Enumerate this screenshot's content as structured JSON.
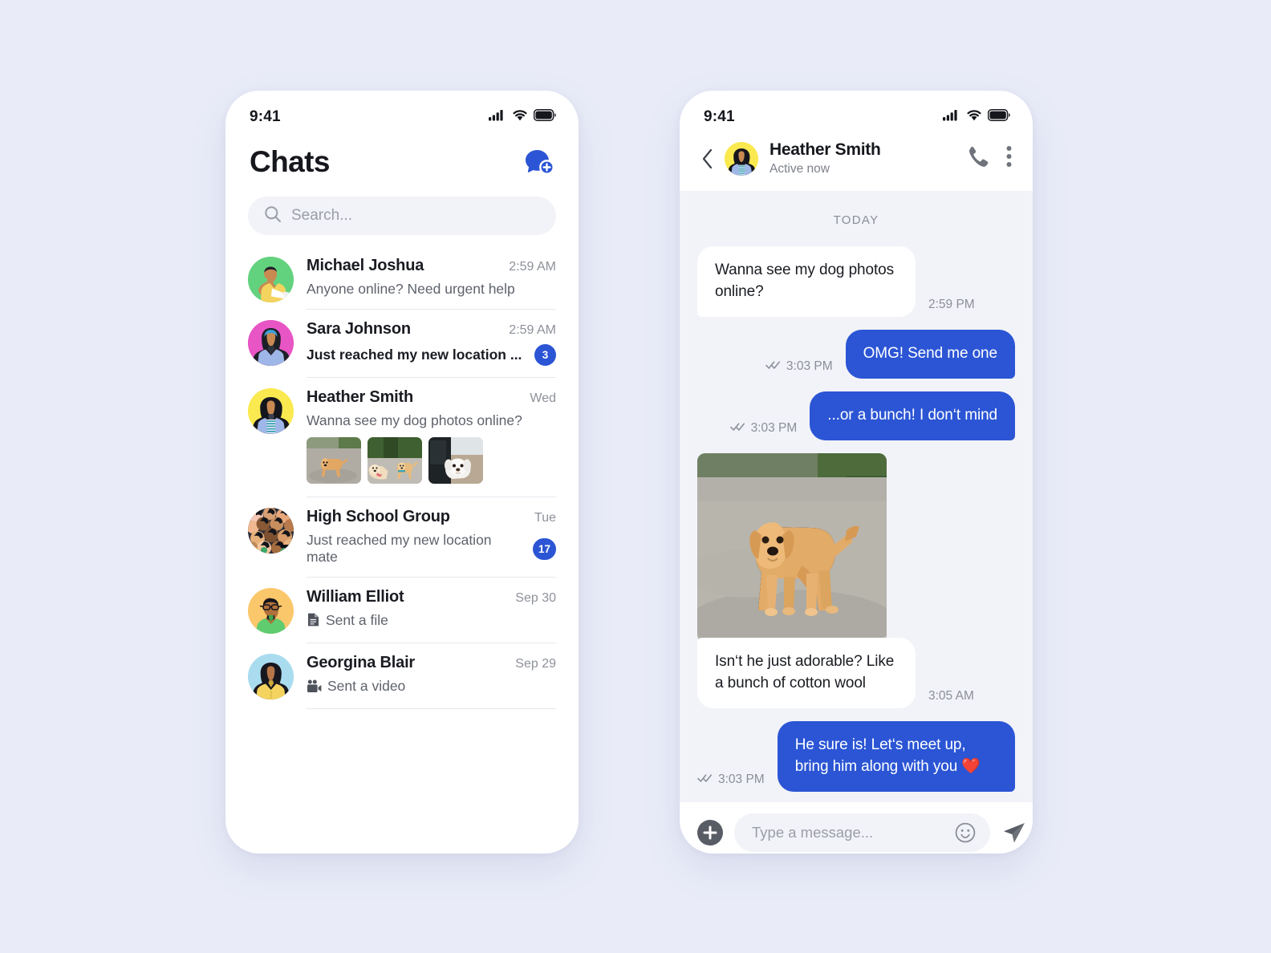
{
  "theme": {
    "page_bg": "#e9ecf8",
    "accent_blue": "#2b55d4",
    "chat_bg": "#f2f3f8",
    "surface": "#ffffff",
    "text_primary": "#1a1c22",
    "text_secondary": "#5e626b",
    "text_muted": "#8b8f99",
    "divider": "#e7e8ee"
  },
  "status_bar": {
    "time": "9:41",
    "icons": [
      "cellular-signal-icon",
      "wifi-icon",
      "battery-icon"
    ]
  },
  "chats_screen": {
    "title": "Chats",
    "new_chat_icon": "new-message-icon",
    "search": {
      "placeholder": "Search...",
      "value": "",
      "icon": "search-icon"
    },
    "items": [
      {
        "name": "Michael Joshua",
        "preview": "Anyone online? Need urgent help",
        "time": "2:59 AM",
        "unread": "",
        "unread_visible": false,
        "avatar_bg": "#63d27f",
        "avatar_kind": "man-yellow-shirt-laptop",
        "preview_icon": "",
        "bold_preview": false,
        "thumbs": []
      },
      {
        "name": "Sara Johnson",
        "preview": "Just reached my new location ...",
        "time": "2:59 AM",
        "unread": "3",
        "unread_visible": true,
        "avatar_bg": "#e855c5",
        "avatar_kind": "woman-hijab",
        "preview_icon": "",
        "bold_preview": true,
        "thumbs": []
      },
      {
        "name": "Heather Smith",
        "preview": "Wanna see my dog photos online?",
        "time": "Wed",
        "unread": "",
        "unread_visible": false,
        "avatar_bg": "#fae94f",
        "avatar_kind": "woman-curly-hair",
        "preview_icon": "",
        "bold_preview": false,
        "thumbs": [
          "golden-puppy-on-road",
          "two-golden-retrievers",
          "white-fluffy-dog"
        ]
      },
      {
        "name": "High School Group",
        "preview": "Just reached my new location mate",
        "time": "Tue",
        "unread": "17",
        "unread_visible": true,
        "avatar_bg": "#3a3a46",
        "avatar_kind": "group-crowd",
        "preview_icon": "",
        "bold_preview": false,
        "thumbs": []
      },
      {
        "name": "William Elliot",
        "preview": "Sent a file",
        "time": "Sep 30",
        "unread": "",
        "unread_visible": false,
        "avatar_bg": "#fbc76b",
        "avatar_kind": "man-glasses-green-shirt",
        "preview_icon": "file-icon",
        "bold_preview": false,
        "thumbs": []
      },
      {
        "name": "Georgina Blair",
        "preview": "Sent a video",
        "time": "Sep 29",
        "unread": "",
        "unread_visible": false,
        "avatar_bg": "#a9dcee",
        "avatar_kind": "woman-yellow-shirt",
        "preview_icon": "video-camera-icon",
        "bold_preview": false,
        "thumbs": []
      }
    ]
  },
  "conversation_screen": {
    "back_icon": "chevron-left-icon",
    "contact_name": "Heather Smith",
    "contact_status": "Active now",
    "contact_avatar_bg": "#fae94f",
    "call_icon": "phone-icon",
    "menu_icon": "more-vertical-icon",
    "day_separator": "TODAY",
    "messages": [
      {
        "kind": "text",
        "direction": "in",
        "text": "Wanna see my dog photos online?",
        "time": "2:59 PM",
        "read_receipt": false
      },
      {
        "kind": "text",
        "direction": "out",
        "text": "OMG! Send me one",
        "time": "3:03 PM",
        "read_receipt": true
      },
      {
        "kind": "text",
        "direction": "out",
        "text": "...or a bunch! I don‘t mind",
        "time": "3:03 PM",
        "read_receipt": true
      },
      {
        "kind": "photo",
        "direction": "in",
        "photo": "golden-retriever-puppy-on-gravel-road",
        "time": "",
        "read_receipt": false
      },
      {
        "kind": "text",
        "direction": "in",
        "text": "Isn‘t he just adorable? Like a bunch of cotton wool",
        "time": "3:05 AM",
        "read_receipt": false
      },
      {
        "kind": "text",
        "direction": "out",
        "text": "He sure is! Let‘s meet up, bring him along with you ❤️",
        "time": "3:03 PM",
        "read_receipt": true
      }
    ],
    "composer": {
      "attach_icon": "plus-circle-icon",
      "placeholder": "Type a message...",
      "value": "",
      "emoji_icon": "smiley-icon",
      "send_icon": "send-icon"
    }
  }
}
